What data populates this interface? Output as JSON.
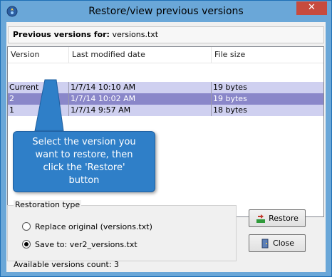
{
  "window": {
    "title": "Restore/view previous versions",
    "close_label": "✕"
  },
  "header": {
    "prefix": "Previous versions for:",
    "filename": "versions.txt"
  },
  "list": {
    "columns": [
      "Version",
      "Last modified date",
      "File size"
    ],
    "rows": [
      {
        "version": "Current",
        "date": "1/7/14 10:10 AM",
        "size": "19 bytes"
      },
      {
        "version": "2",
        "date": "1/7/14 10:02 AM",
        "size": "19 bytes"
      },
      {
        "version": "1",
        "date": "1/7/14 9:57 AM",
        "size": "18 bytes"
      }
    ]
  },
  "callout": {
    "line1": "Select the version you",
    "line2": "want to restore, then",
    "line3": "click the 'Restore'",
    "line4": "button"
  },
  "restoration": {
    "group_label": "Restoration type",
    "option_replace": "Replace original (versions.txt)",
    "option_save": "Save to: ver2_versions.txt",
    "selected": "save"
  },
  "buttons": {
    "restore": "Restore",
    "close": "Close"
  },
  "status": {
    "text": "Available versions count: 3"
  },
  "colors": {
    "title_bar": "#6aa7d8",
    "close_button": "#c74b3e",
    "callout": "#2f7fc8",
    "row_selected_current": "#cfd0f0",
    "row_selected_dark": "#8a87c9"
  }
}
